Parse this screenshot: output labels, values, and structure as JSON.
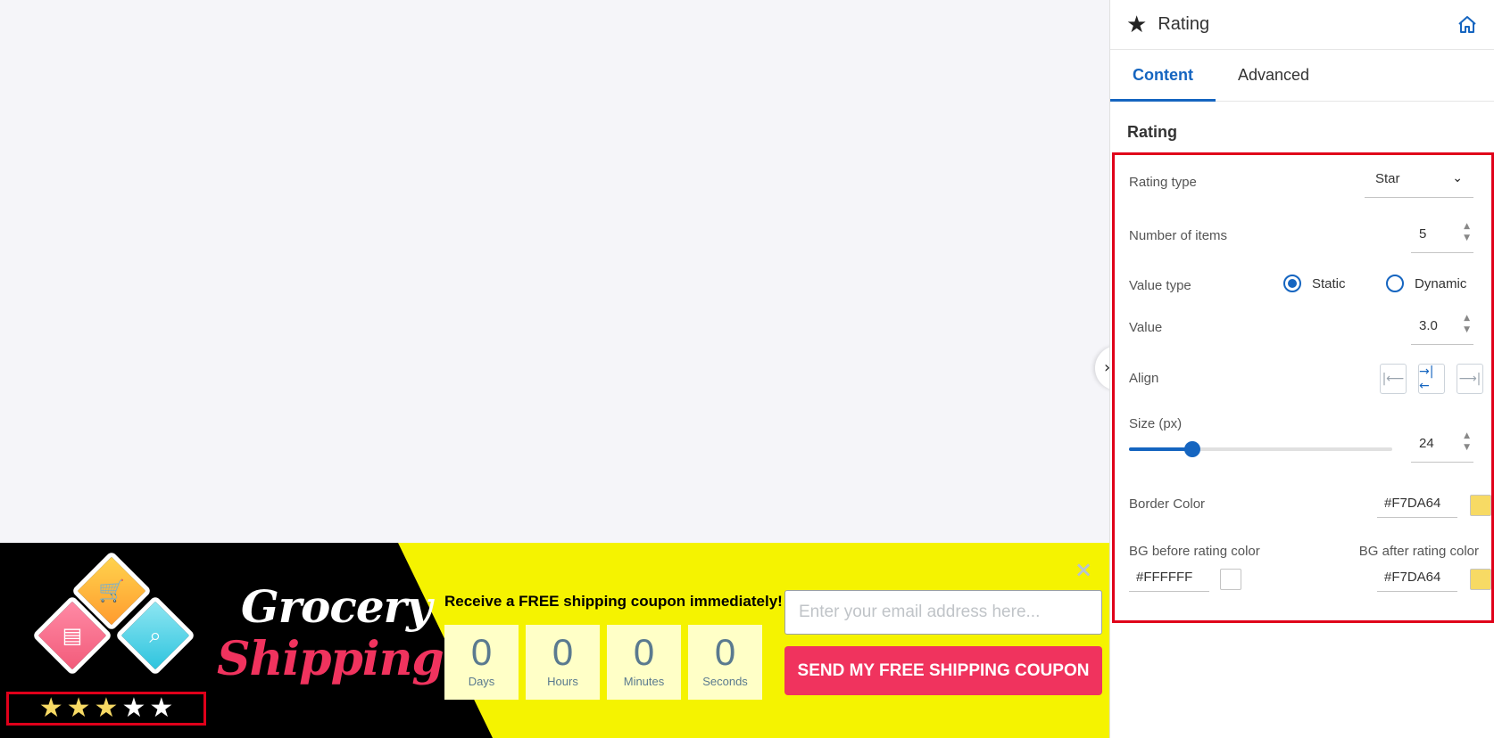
{
  "colors": {
    "accent": "#1565c0",
    "rating_border": "#F7DA64",
    "highlight": "#e0001a",
    "banner_yellow": "#f5f300",
    "cta": "#f0335e"
  },
  "banner": {
    "brand_line1": "Grocery",
    "brand_line2": "Shipping",
    "headline": "Receive a FREE shipping coupon immediately!",
    "countdown": [
      {
        "value": "0",
        "label": "Days"
      },
      {
        "value": "0",
        "label": "Hours"
      },
      {
        "value": "0",
        "label": "Minutes"
      },
      {
        "value": "0",
        "label": "Seconds"
      }
    ],
    "email_placeholder": "Enter your email address here...",
    "cta_label": "SEND MY FREE SHIPPING COUPON",
    "close_icon": "×",
    "rating": {
      "value": 3.0,
      "max": 5,
      "star_glyph": "★"
    }
  },
  "panel": {
    "title": "Rating",
    "title_icon": "star-icon",
    "home_icon": "home-icon",
    "tabs": [
      {
        "label": "Content",
        "active": true
      },
      {
        "label": "Advanced",
        "active": false
      }
    ],
    "section_title": "Rating",
    "rating_type": {
      "label": "Rating type",
      "value": "Star"
    },
    "number_of_items": {
      "label": "Number of items",
      "value": "5"
    },
    "value_type": {
      "label": "Value type",
      "options": [
        {
          "label": "Static",
          "selected": true
        },
        {
          "label": "Dynamic",
          "selected": false
        }
      ]
    },
    "value": {
      "label": "Value",
      "value": "3.0"
    },
    "align": {
      "label": "Align",
      "options": [
        "left",
        "center",
        "right"
      ],
      "selected": "center"
    },
    "size": {
      "label": "Size (px)",
      "value": "24",
      "min": 0,
      "max": 100
    },
    "border_color": {
      "label": "Border Color",
      "value": "#F7DA64"
    },
    "bg_before": {
      "label": "BG before rating color",
      "value": "#FFFFFF"
    },
    "bg_after": {
      "label": "BG after rating color",
      "value": "#F7DA64"
    }
  }
}
